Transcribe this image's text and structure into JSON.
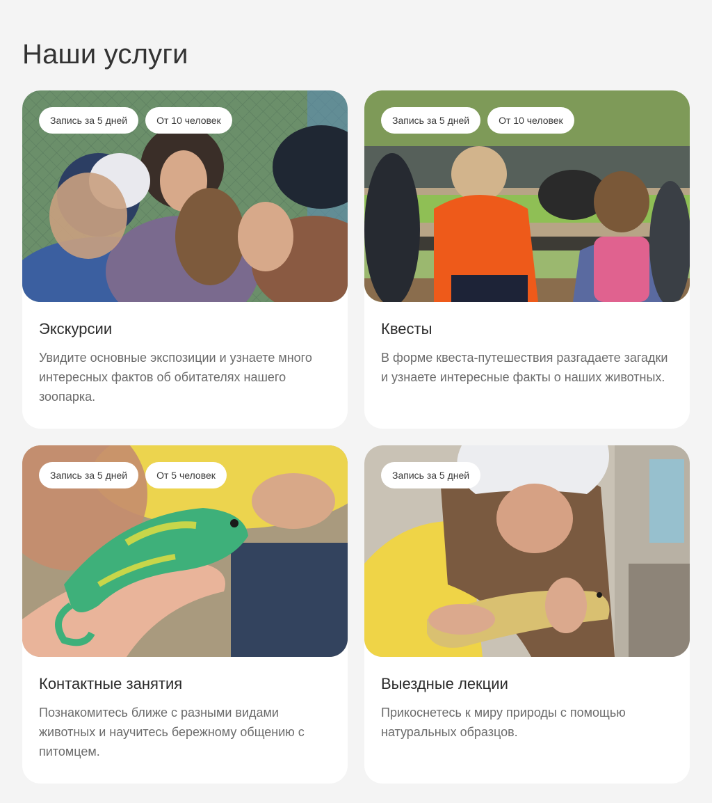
{
  "page": {
    "title": "Наши услуги"
  },
  "services": [
    {
      "title": "Экскурсии",
      "tags": [
        "Запись за 5 дней",
        "От 10 человек"
      ],
      "description": "Увидите основные экспозиции и узнаете много интересных фактов об обитателях нашего зоопарка.",
      "photo": "children-with-guide-photo"
    },
    {
      "title": "Квесты",
      "tags": [
        "Запись за 5 дней",
        "От 10 человек"
      ],
      "description": "В форме квеста-путешествия разгадаете загадки и узнаете интересные факты о наших животных.",
      "photo": "children-at-enclosure-photo"
    },
    {
      "title": "Контактные занятия",
      "tags": [
        "Запись за 5 дней",
        "От 5 человек"
      ],
      "description": "Познакомитесь ближе с разными видами животных и научитесь бережному общению с питомцем.",
      "photo": "chameleon-on-hand-photo"
    },
    {
      "title": "Выездные лекции",
      "tags": [
        "Запись за 5 дней"
      ],
      "description": "Прикоснетесь к миру природы с помощью натуральных образцов.",
      "photo": "girl-holding-lizard-photo"
    }
  ]
}
